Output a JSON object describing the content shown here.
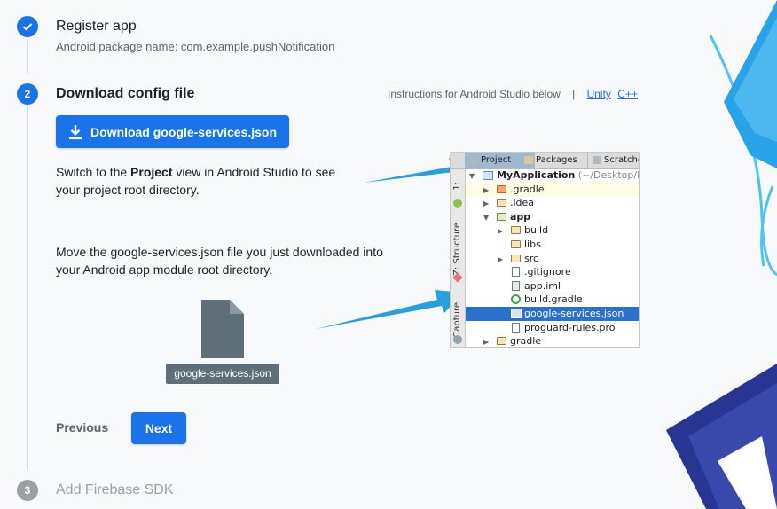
{
  "steps": [
    {
      "number": "",
      "title": "Register app",
      "subtitle": "Android package name: com.example.pushNotification",
      "state": "done"
    },
    {
      "number": "2",
      "title": "Download config file",
      "state": "active"
    },
    {
      "number": "3",
      "title": "Add Firebase SDK",
      "state": "pending"
    }
  ],
  "instructions": {
    "text": "Instructions for Android Studio below",
    "separator": "|",
    "links": [
      "Unity",
      "C++"
    ]
  },
  "download_button": {
    "label": "Download google-services.json",
    "icon": "download-icon"
  },
  "switch_text": {
    "before": "Switch to the ",
    "bold": "Project",
    "after": " view in Android Studio to see your project root directory."
  },
  "move_text": "Move the google-services.json file you just downloaded into your Android app module root directory.",
  "file": {
    "label": "google-services.json",
    "icon": "file-icon"
  },
  "nav": {
    "previous": "Previous",
    "next": "Next"
  },
  "ide": {
    "tabs": [
      "Project",
      "Packages",
      "Scratche"
    ],
    "side_tabs": [
      "1:",
      "Z: Structure",
      "Capture"
    ],
    "tree": [
      {
        "label": "MyApplication",
        "suffix": "(~/Desktop/My",
        "icon": "module-icon",
        "expander": "open",
        "bold": true
      },
      {
        "label": ".gradle",
        "icon": "folder-icon",
        "expander": "closed",
        "highlight": true
      },
      {
        "label": ".idea",
        "icon": "folder-icon",
        "expander": "closed"
      },
      {
        "label": "app",
        "icon": "module-folder-icon",
        "expander": "open",
        "bold": true
      },
      {
        "label": "build",
        "icon": "folder-icon",
        "expander": "closed"
      },
      {
        "label": "libs",
        "icon": "folder-icon",
        "expander": "none"
      },
      {
        "label": "src",
        "icon": "folder-icon",
        "expander": "closed"
      },
      {
        "label": ".gitignore",
        "icon": "file-icon",
        "expander": "none"
      },
      {
        "label": "app.iml",
        "icon": "file-icon",
        "expander": "none"
      },
      {
        "label": "build.gradle",
        "icon": "gradle-icon",
        "expander": "none"
      },
      {
        "label": "google-services.json",
        "icon": "json-file-icon",
        "expander": "none",
        "selected": true
      },
      {
        "label": "proguard-rules.pro",
        "icon": "file-icon",
        "expander": "none"
      },
      {
        "label": "gradle",
        "icon": "folder-icon",
        "expander": "closed"
      }
    ]
  },
  "colors": {
    "accent": "#1a73e8",
    "pending": "#9aa0a6",
    "text": "#202124",
    "muted": "#5f6368",
    "arrow": "#2a9fe0",
    "selection": "#2b70c9"
  }
}
